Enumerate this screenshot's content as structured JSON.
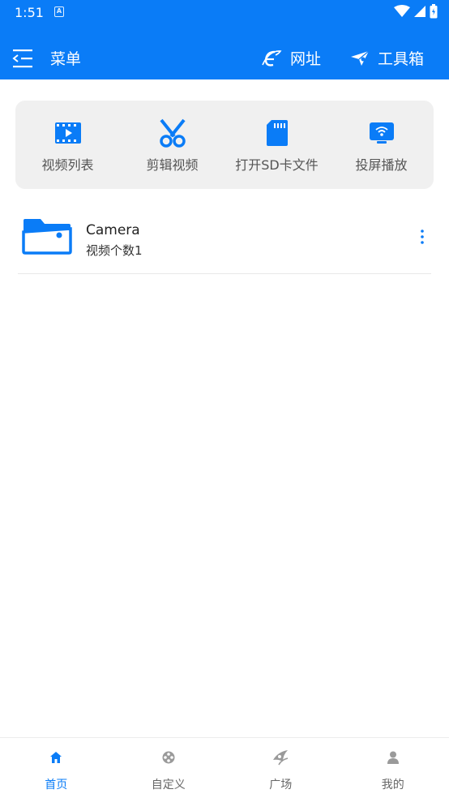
{
  "status_bar": {
    "time": "1:51",
    "notification_letter": "A"
  },
  "app_bar": {
    "menu_label": "菜单",
    "url_label": "网址",
    "tools_label": "工具箱"
  },
  "quick_actions": [
    {
      "label": "视频列表",
      "icon": "video-list-icon"
    },
    {
      "label": "剪辑视频",
      "icon": "scissors-icon"
    },
    {
      "label": "打开SD卡文件",
      "icon": "sd-card-icon"
    },
    {
      "label": "投屏播放",
      "icon": "cast-screen-icon"
    }
  ],
  "folders": [
    {
      "name": "Camera",
      "count": "视频个数1"
    }
  ],
  "bottom_nav": [
    {
      "label": "首页",
      "icon": "home-icon",
      "active": true
    },
    {
      "label": "自定义",
      "icon": "film-reel-icon",
      "active": false
    },
    {
      "label": "广场",
      "icon": "plaza-icon",
      "active": false
    },
    {
      "label": "我的",
      "icon": "profile-icon",
      "active": false
    }
  ],
  "colors": {
    "primary": "#0a7cf7",
    "card_background": "#f0f0f0",
    "inactive_icon": "#9a9a9a"
  }
}
